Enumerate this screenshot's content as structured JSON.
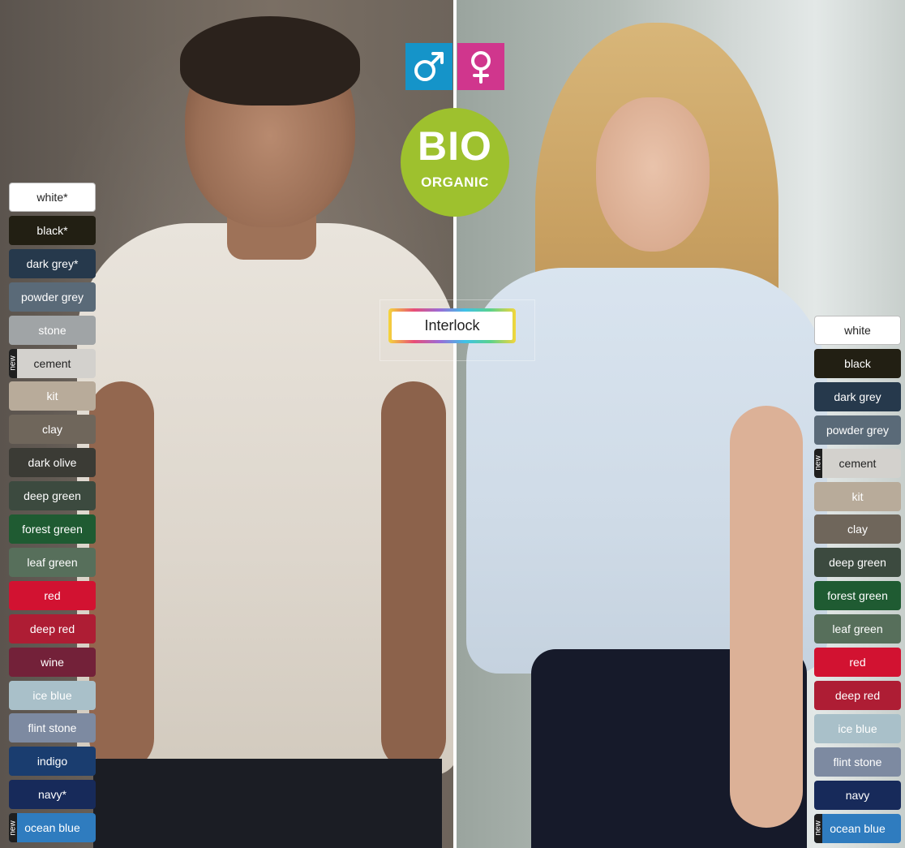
{
  "gender_icons": {
    "male": {
      "icon": "male-symbol-icon",
      "color": "#1594c9"
    },
    "female": {
      "icon": "female-symbol-icon",
      "color": "#d0368d"
    }
  },
  "badge": {
    "big": "BIO",
    "small": "ORGANIC",
    "color": "#9ec12e"
  },
  "feature_label": "Interlock",
  "new_tag": "new",
  "men_colors": [
    {
      "label": "white*",
      "color": "#ffffff",
      "is_new": false
    },
    {
      "label": "black*",
      "color": "#221f13",
      "is_new": false
    },
    {
      "label": "dark grey*",
      "color": "#26394c",
      "is_new": false
    },
    {
      "label": "powder grey",
      "color": "#5a6a78",
      "is_new": false
    },
    {
      "label": "stone",
      "color": "#a0a4a6",
      "is_new": false
    },
    {
      "label": "cement",
      "color": "#d3d1cd",
      "is_new": true
    },
    {
      "label": "kit",
      "color": "#b8ab9a",
      "is_new": false
    },
    {
      "label": "clay",
      "color": "#6f665b",
      "is_new": false
    },
    {
      "label": "dark olive",
      "color": "#3b3b35",
      "is_new": false
    },
    {
      "label": "deep green",
      "color": "#3c4a3f",
      "is_new": false
    },
    {
      "label": "forest green",
      "color": "#1f5b32",
      "is_new": false
    },
    {
      "label": "leaf green",
      "color": "#576f5b",
      "is_new": false
    },
    {
      "label": "red",
      "color": "#d21231",
      "is_new": false
    },
    {
      "label": "deep red",
      "color": "#ae1d34",
      "is_new": false
    },
    {
      "label": "wine",
      "color": "#732139",
      "is_new": false
    },
    {
      "label": "ice blue",
      "color": "#a9c0c9",
      "is_new": false
    },
    {
      "label": "flint stone",
      "color": "#7d8aa1",
      "is_new": false
    },
    {
      "label": "indigo",
      "color": "#1a3d6f",
      "is_new": false
    },
    {
      "label": "navy*",
      "color": "#172a5a",
      "is_new": false
    },
    {
      "label": "ocean blue",
      "color": "#2f7cbf",
      "is_new": true
    }
  ],
  "women_colors": [
    {
      "label": "white",
      "color": "#ffffff",
      "is_new": false
    },
    {
      "label": "black",
      "color": "#221f13",
      "is_new": false
    },
    {
      "label": "dark grey",
      "color": "#26394c",
      "is_new": false
    },
    {
      "label": "powder grey",
      "color": "#5a6a78",
      "is_new": false
    },
    {
      "label": "cement",
      "color": "#d3d1cd",
      "is_new": true
    },
    {
      "label": "kit",
      "color": "#b8ab9a",
      "is_new": false
    },
    {
      "label": "clay",
      "color": "#6f665b",
      "is_new": false
    },
    {
      "label": "deep green",
      "color": "#3c4a3f",
      "is_new": false
    },
    {
      "label": "forest green",
      "color": "#1f5b32",
      "is_new": false
    },
    {
      "label": "leaf green",
      "color": "#576f5b",
      "is_new": false
    },
    {
      "label": "red",
      "color": "#d21231",
      "is_new": false
    },
    {
      "label": "deep red",
      "color": "#ae1d34",
      "is_new": false
    },
    {
      "label": "ice blue",
      "color": "#a9c0c9",
      "is_new": false
    },
    {
      "label": "flint stone",
      "color": "#7d8aa1",
      "is_new": false
    },
    {
      "label": "navy",
      "color": "#172a5a",
      "is_new": false
    },
    {
      "label": "ocean blue",
      "color": "#2f7cbf",
      "is_new": true
    }
  ]
}
